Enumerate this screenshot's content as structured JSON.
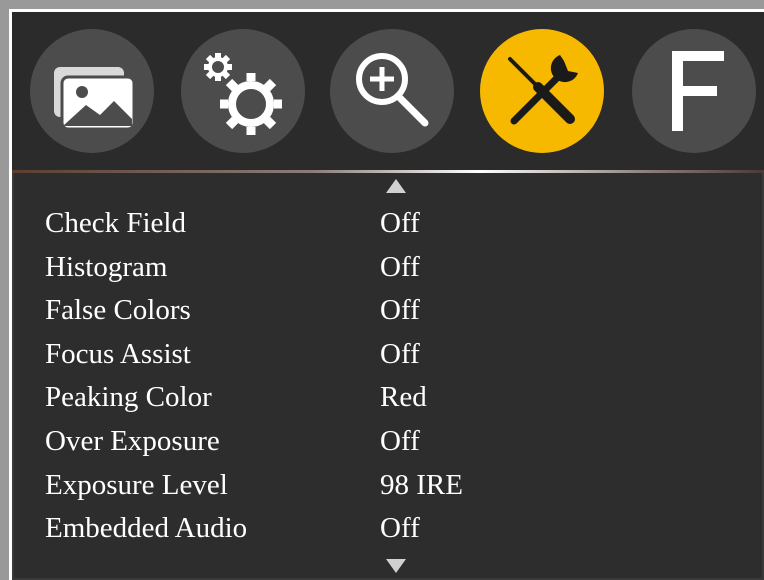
{
  "menu_tabs": [
    {
      "icon": "picture-icon",
      "active": false
    },
    {
      "icon": "gears-icon",
      "active": false
    },
    {
      "icon": "zoom-in-icon",
      "active": false
    },
    {
      "icon": "tools-icon",
      "active": true
    },
    {
      "icon": "function-icon",
      "label": "F",
      "active": false
    }
  ],
  "colors": {
    "background": "#2d2d2d",
    "tab_inactive": "#4c4c4c",
    "tab_active": "#f7b900",
    "text": "#ffffff"
  },
  "settings": [
    {
      "label": "Check Field",
      "value": "Off"
    },
    {
      "label": "Histogram",
      "value": "Off"
    },
    {
      "label": "False Colors",
      "value": "Off"
    },
    {
      "label": "Focus Assist",
      "value": "Off"
    },
    {
      "label": "Peaking Color",
      "value": "Red"
    },
    {
      "label": "Over Exposure",
      "value": "Off"
    },
    {
      "label": "Exposure Level",
      "value": "98 IRE"
    },
    {
      "label": "Embedded Audio",
      "value": "Off"
    }
  ]
}
